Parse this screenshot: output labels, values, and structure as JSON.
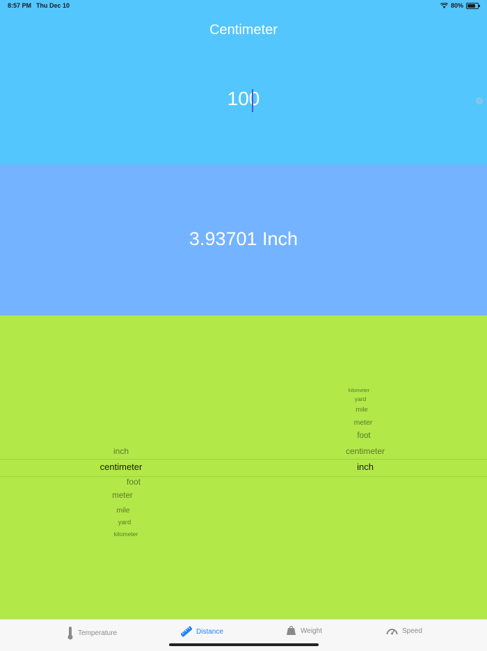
{
  "status_bar": {
    "time": "8:57 PM",
    "date": "Thu Dec 10",
    "battery": "80%",
    "battery_level": 0.8
  },
  "input_panel": {
    "unit_title": "Centimeter",
    "value": "100",
    "clear_icon": "clear-circle-icon"
  },
  "result_panel": {
    "text": "3.93701 Inch"
  },
  "picker": {
    "from_column": {
      "above": [
        "inch"
      ],
      "selected": "centimeter",
      "below": [
        "foot",
        "meter",
        "mile",
        "yard",
        "kilometer"
      ]
    },
    "to_column": {
      "above": [
        "kilometer",
        "yard",
        "mile",
        "meter",
        "foot",
        "centimeter"
      ],
      "selected": "inch",
      "below": []
    }
  },
  "tab_bar": {
    "tabs": [
      {
        "label": "Temperature",
        "icon": "thermometer-icon",
        "active": false
      },
      {
        "label": "Distance",
        "icon": "ruler-icon",
        "active": true
      },
      {
        "label": "Weight",
        "icon": "weight-icon",
        "active": false
      },
      {
        "label": "Speed",
        "icon": "speedometer-icon",
        "active": false
      }
    ]
  },
  "colors": {
    "input_bg": "#53c6fe",
    "result_bg": "#74b3ff",
    "picker_bg": "#b2e848",
    "active_tab": "#1e84f3"
  }
}
